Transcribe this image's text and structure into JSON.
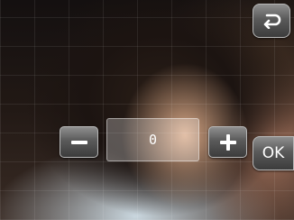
{
  "controls": {
    "value": "0",
    "ok_label": "OK"
  },
  "icons": {
    "back": "return-arrow-icon",
    "decrease": "minus-icon",
    "increase": "plus-icon"
  },
  "background": {
    "type": "photo",
    "grid": true
  }
}
